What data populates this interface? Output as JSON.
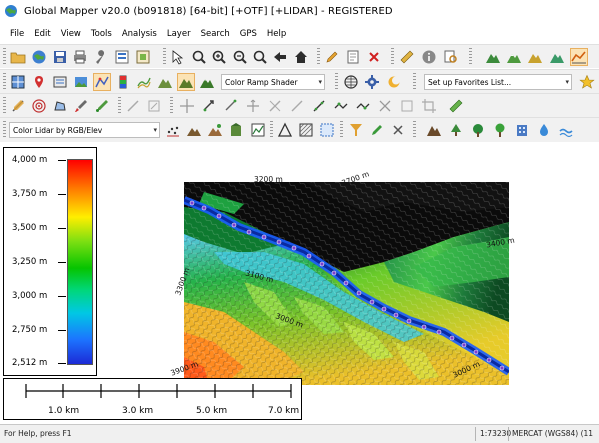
{
  "window": {
    "title": "Global Mapper v20.0 (b091818) [64-bit] [+OTF] [+LIDAR] - REGISTERED"
  },
  "menu": [
    "File",
    "Edit",
    "View",
    "Tools",
    "Analysis",
    "Layer",
    "Search",
    "GPS",
    "Help"
  ],
  "toolbar2": {
    "shader_select": "Color Ramp Shader",
    "favorites_select": "Set up Favorites List..."
  },
  "toolbar4": {
    "lidar_color_select": "Color Lidar by RGB/Elev"
  },
  "legend": {
    "labels": [
      "4,000 m",
      "3,750 m",
      "3,500 m",
      "3,250 m",
      "3,000 m",
      "2,750 m",
      "2,512 m"
    ],
    "colors": [
      "#ff0000",
      "#ff7a00",
      "#ffee00",
      "#06c400",
      "#00d77c",
      "#00c8e4",
      "#1c74ff",
      "#1c2ad6"
    ]
  },
  "scalebar": {
    "labels": [
      "1.0 km",
      "3.0 km",
      "5.0 km",
      "7.0 km"
    ]
  },
  "map_labels": {
    "c1": "3200 m",
    "c2": "3700 m",
    "c3": "3400 m",
    "c4": "3300 m",
    "c5": "3100 m",
    "c6": "3000 m",
    "c7": "3900 m",
    "c8": "3000 m"
  },
  "statusbar": {
    "help": "For Help, press F1",
    "scale": "1:73230",
    "projection": "MERCAT (WGS84) (11"
  },
  "accent": {
    "water_points": "#7b3fd0",
    "river": "#0a3cff"
  }
}
